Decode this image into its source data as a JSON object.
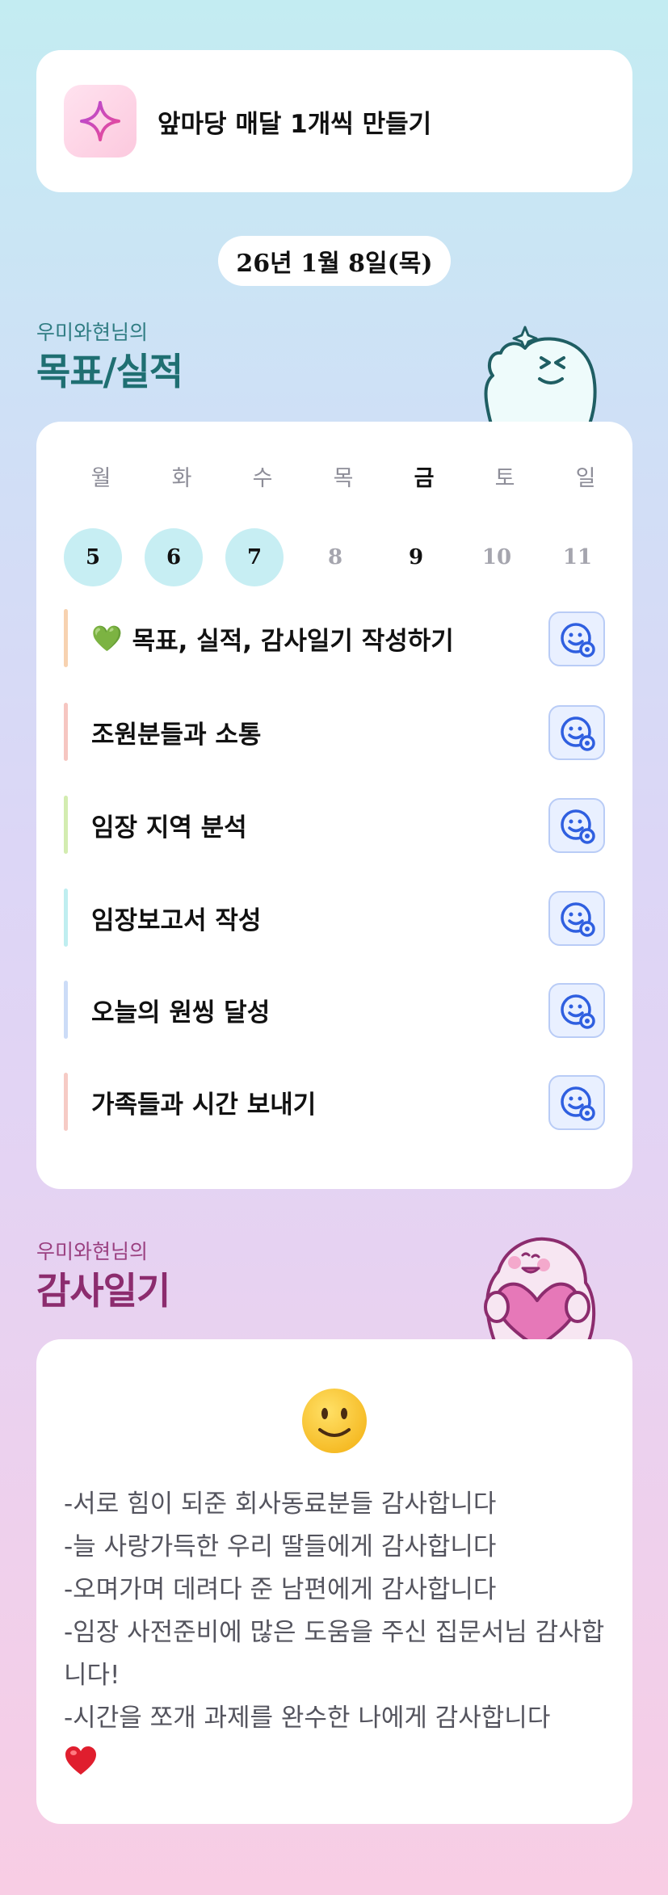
{
  "goal": {
    "text": "앞마당 매달 1개씩 만들기",
    "icon": "sparkle-icon"
  },
  "date": "26년 1월 8일(목)",
  "goals_section": {
    "subtitle": "우미와현님의",
    "title": "목표/실적"
  },
  "week": {
    "days": [
      {
        "label": "월",
        "num": "5",
        "state": "done"
      },
      {
        "label": "화",
        "num": "6",
        "state": "done"
      },
      {
        "label": "수",
        "num": "7",
        "state": "done"
      },
      {
        "label": "목",
        "num": "8",
        "state": "normal"
      },
      {
        "label": "금",
        "num": "9",
        "state": "today"
      },
      {
        "label": "토",
        "num": "10",
        "state": "normal"
      },
      {
        "label": "일",
        "num": "11",
        "state": "normal"
      }
    ]
  },
  "tasks": [
    {
      "label": "목표, 실적, 감사일기 작성하기",
      "emoji": "💚",
      "color": "#f7d2b0"
    },
    {
      "label": "조원분들과 소통",
      "color": "#f6c6c1"
    },
    {
      "label": "임장 지역 분석",
      "color": "#d3ecb0"
    },
    {
      "label": "임장보고서 작성",
      "color": "#bfeef0"
    },
    {
      "label": "오늘의 원씽 달성",
      "color": "#ccdcf7"
    },
    {
      "label": "가족들과 시간 보내기",
      "color": "#f6cbc5"
    }
  ],
  "diary_section": {
    "subtitle": "우미와현님의",
    "title": "감사일기"
  },
  "diary": {
    "lines": [
      "-서로 힘이 되준 회사동료분들 감사합니다",
      "-늘 사랑가득한 우리 딸들에게 감사합니다",
      "-오며가며 데려다 준 남편에게 감사합니다",
      "-임장 사전준비에 많은 도움을 주신 집문서님 감사합니다!",
      "-시간을 쪼개 과제를 완수한 나에게 감사합니다"
    ],
    "end_emoji": "heart-icon"
  },
  "colors": {
    "accent_teal": "#1f6f72",
    "accent_plum": "#8c2c6e",
    "button_blue": "#2f5fe0"
  }
}
